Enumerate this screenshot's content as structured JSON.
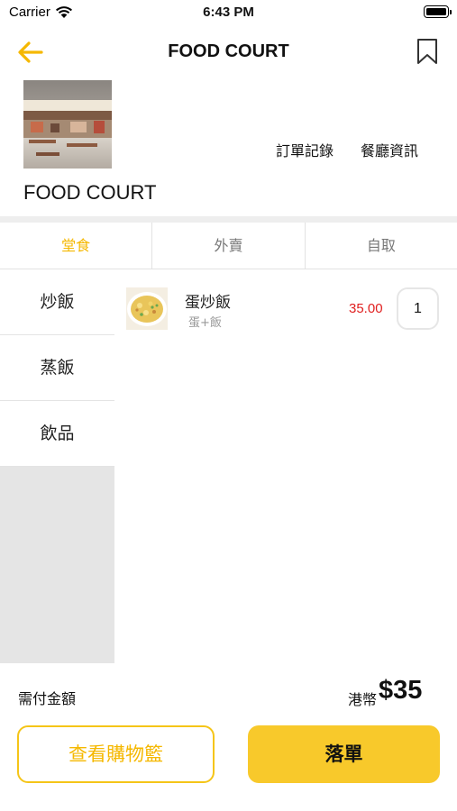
{
  "status_bar": {
    "carrier": "Carrier",
    "time": "6:43 PM"
  },
  "nav": {
    "title": "FOOD COURT",
    "back_icon": "arrow-left-icon",
    "bookmark_icon": "bookmark-icon"
  },
  "shop": {
    "name": "FOOD COURT",
    "links": {
      "order_history": "訂單記錄",
      "restaurant_info": "餐廳資訊"
    }
  },
  "tabs": [
    {
      "label": "堂食",
      "active": true
    },
    {
      "label": "外賣",
      "active": false
    },
    {
      "label": "自取",
      "active": false
    }
  ],
  "categories": [
    {
      "label": "炒飯"
    },
    {
      "label": "蒸飯"
    },
    {
      "label": "飲品"
    }
  ],
  "menu": [
    {
      "name": "蛋炒飯",
      "description": "蛋+飯",
      "price": "35.00",
      "quantity": "1"
    }
  ],
  "summary": {
    "total_label": "需付金額",
    "currency": "港幣",
    "amount": "$35"
  },
  "buttons": {
    "view_cart": "查看購物籃",
    "place_order": "落單"
  },
  "colors": {
    "accent": "#F5C518",
    "price": "#E02020",
    "tab_active": "#F5B800"
  }
}
